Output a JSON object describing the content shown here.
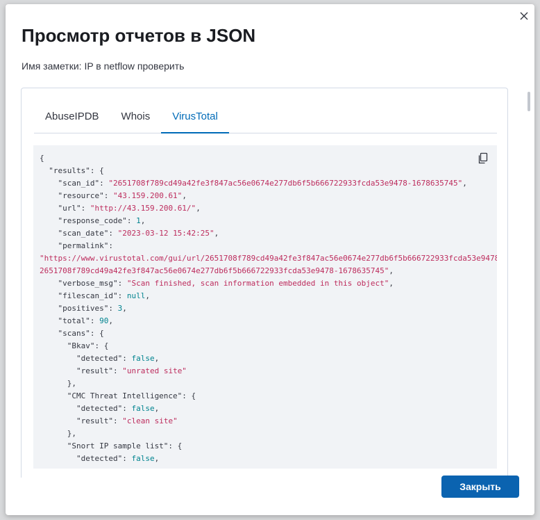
{
  "modal": {
    "title": "Просмотр отчетов в JSON",
    "subtitle": "Имя заметки: IP в netflow проверить",
    "close_icon": "close-icon",
    "close_button_label": "Закрыть"
  },
  "tabs": [
    {
      "label": "AbuseIPDB",
      "active": false
    },
    {
      "label": "Whois",
      "active": false
    },
    {
      "label": "VirusTotal",
      "active": true
    }
  ],
  "colors": {
    "accent": "#006bb8",
    "button": "#0b63b0",
    "string": "#bd2c5d",
    "number": "#00838f"
  },
  "json_lines": [
    [
      [
        "k",
        "{"
      ]
    ],
    [
      [
        "k",
        "  \"results\": {"
      ]
    ],
    [
      [
        "k",
        "    \"scan_id\": "
      ],
      [
        "s",
        "\"2651708f789cd49a42fe3f847ac56e0674e277db6f5b666722933fcda53e9478-1678635745\""
      ],
      [
        "k",
        ","
      ]
    ],
    [
      [
        "k",
        "    \"resource\": "
      ],
      [
        "s",
        "\"43.159.200.61\""
      ],
      [
        "k",
        ","
      ]
    ],
    [
      [
        "k",
        "    \"url\": "
      ],
      [
        "s",
        "\"http://43.159.200.61/\""
      ],
      [
        "k",
        ","
      ]
    ],
    [
      [
        "k",
        "    \"response_code\": "
      ],
      [
        "n",
        "1"
      ],
      [
        "k",
        ","
      ]
    ],
    [
      [
        "k",
        "    \"scan_date\": "
      ],
      [
        "s",
        "\"2023-03-12 15:42:25\""
      ],
      [
        "k",
        ","
      ]
    ],
    [
      [
        "k",
        "    \"permalink\":"
      ]
    ],
    [
      [
        "s",
        "\"https://www.virustotal.com/gui/url/2651708f789cd49a42fe3f847ac56e0674e277db6f5b666722933fcda53e9478"
      ]
    ],
    [
      [
        "s",
        "2651708f789cd49a42fe3f847ac56e0674e277db6f5b666722933fcda53e9478-1678635745\""
      ],
      [
        "k",
        ","
      ]
    ],
    [
      [
        "k",
        "    \"verbose_msg\": "
      ],
      [
        "s",
        "\"Scan finished, scan information embedded in this object\""
      ],
      [
        "k",
        ","
      ]
    ],
    [
      [
        "k",
        "    \"filescan_id\": "
      ],
      [
        "n",
        "null"
      ],
      [
        "k",
        ","
      ]
    ],
    [
      [
        "k",
        "    \"positives\": "
      ],
      [
        "n",
        "3"
      ],
      [
        "k",
        ","
      ]
    ],
    [
      [
        "k",
        "    \"total\": "
      ],
      [
        "n",
        "90"
      ],
      [
        "k",
        ","
      ]
    ],
    [
      [
        "k",
        "    \"scans\": {"
      ]
    ],
    [
      [
        "k",
        "      \"Bkav\": {"
      ]
    ],
    [
      [
        "k",
        "        \"detected\": "
      ],
      [
        "n",
        "false"
      ],
      [
        "k",
        ","
      ]
    ],
    [
      [
        "k",
        "        \"result\": "
      ],
      [
        "s",
        "\"unrated site\""
      ]
    ],
    [
      [
        "k",
        "      },"
      ]
    ],
    [
      [
        "k",
        "      \"CMC Threat Intelligence\": {"
      ]
    ],
    [
      [
        "k",
        "        \"detected\": "
      ],
      [
        "n",
        "false"
      ],
      [
        "k",
        ","
      ]
    ],
    [
      [
        "k",
        "        \"result\": "
      ],
      [
        "s",
        "\"clean site\""
      ]
    ],
    [
      [
        "k",
        "      },"
      ]
    ],
    [
      [
        "k",
        "      \"Snort IP sample list\": {"
      ]
    ],
    [
      [
        "k",
        "        \"detected\": "
      ],
      [
        "n",
        "false"
      ],
      [
        "k",
        ","
      ]
    ]
  ]
}
